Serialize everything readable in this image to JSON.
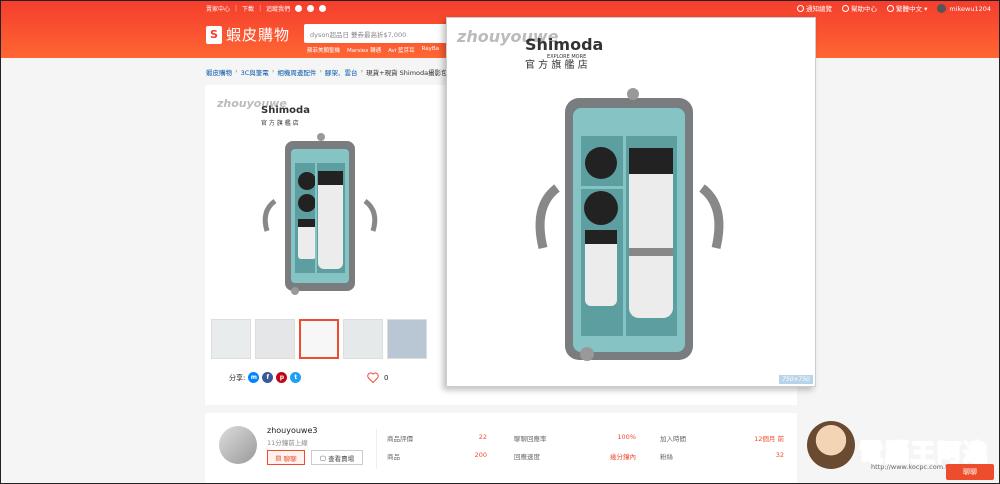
{
  "topnav": {
    "seller_center": "賣家中心",
    "download": "下載",
    "follow_us": "追蹤我們"
  },
  "topright": {
    "notifications": "通知總覽",
    "help": "幫助中心",
    "language": "繁體中文",
    "username": "mikewu1204"
  },
  "logo": {
    "text": "蝦皮購物"
  },
  "search": {
    "placeholder": "dyson超品日 雙券最高折$7,000"
  },
  "hotwords": [
    "蘇菲美顏聖機",
    "Marsiex 轉通",
    "Avi 藍芽耳",
    "RayBa"
  ],
  "breadcrumb": [
    "蝦皮購物",
    "3C與筆電",
    "相機周邊配件",
    "腳架、雲台",
    "現貨+現貨 Shimoda攝影包"
  ],
  "watermark": {
    "user": "zhouyouwe",
    "brand": "Shimoda",
    "brand_sub": "EXPLORE MORE",
    "store": "官 方 旗 艦 店"
  },
  "zoom": {
    "size_label": "750×750"
  },
  "share": {
    "label": "分享:"
  },
  "like": {
    "count": "0"
  },
  "shop": {
    "name": "zhouyouwe3",
    "online": "11分鐘前上線",
    "chat_label": "聊聊",
    "view_shop_label": "查看賣場",
    "stats": [
      {
        "label": "商品評價",
        "value": "22"
      },
      {
        "label": "商品",
        "value": "200"
      },
      {
        "label": "聊聊回應率",
        "value": "100%"
      },
      {
        "label": "回應速度",
        "value": "幾分鐘內"
      },
      {
        "label": "加入時間",
        "value": "12個月 前"
      },
      {
        "label": "粉絲",
        "value": "32"
      }
    ]
  },
  "badge": {
    "title": "電腦王阿達",
    "url": "http://www.kocpc.com.tw"
  },
  "chat_float": {
    "label": "聊聊"
  },
  "colors": {
    "brand": "#ee4d2d",
    "bag_teal": "#86c3c5",
    "bag_gray": "#8a8d90"
  }
}
